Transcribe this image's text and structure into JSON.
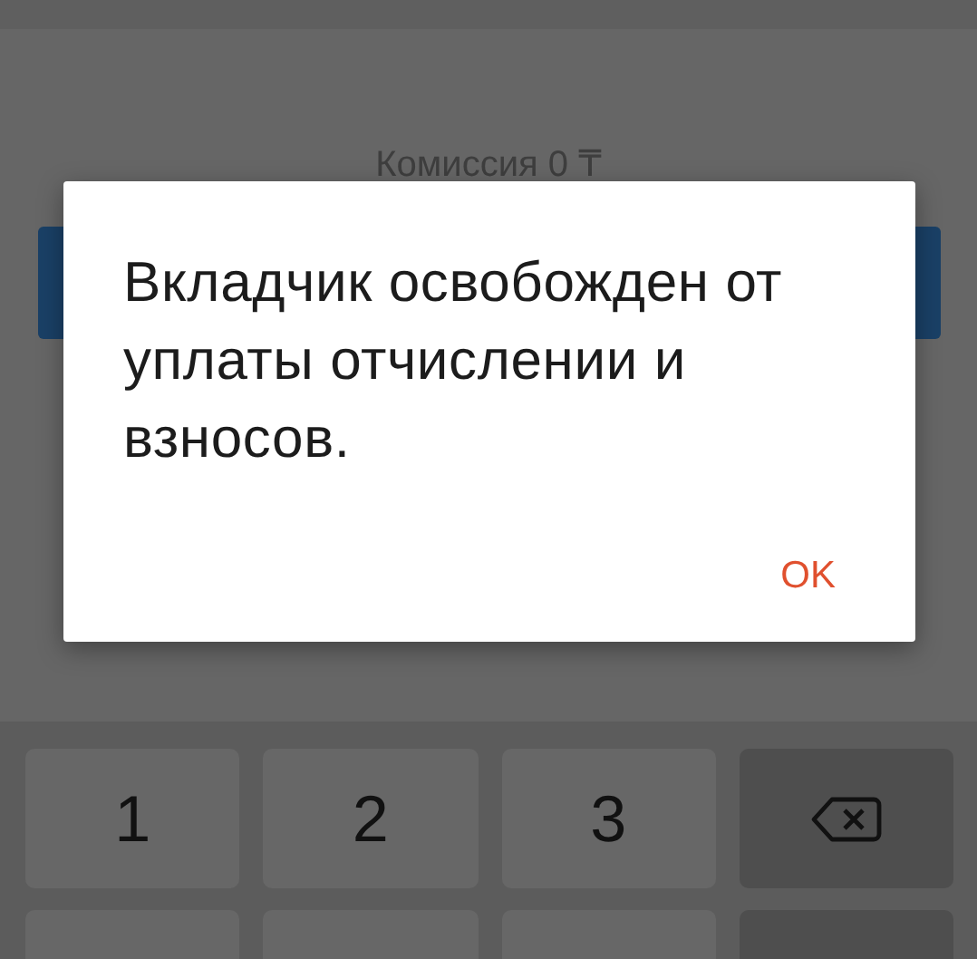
{
  "commission": "Комиссия 0 ₸",
  "dialog": {
    "message": "Вкладчик освобожден от уплаты отчислении и взносов.",
    "buttons": [
      "OK"
    ]
  },
  "keypad": {
    "rows": [
      [
        {
          "kind": "digit",
          "label": "1"
        },
        {
          "kind": "digit",
          "label": "2"
        },
        {
          "kind": "digit",
          "label": "3"
        },
        {
          "kind": "backspace"
        }
      ],
      [
        {
          "kind": "digit"
        },
        {
          "kind": "digit"
        },
        {
          "kind": "digit"
        },
        {
          "kind": "action"
        }
      ]
    ]
  }
}
